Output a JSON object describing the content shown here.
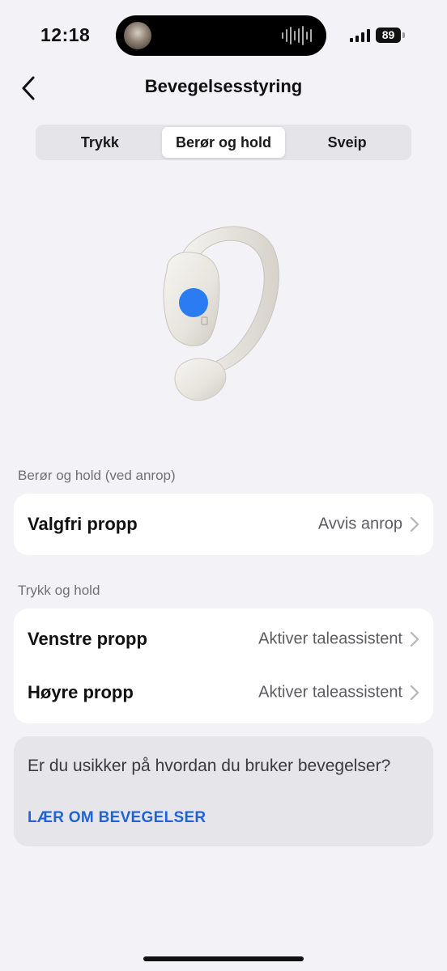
{
  "status_bar": {
    "time": "12:18",
    "battery": "89"
  },
  "header": {
    "title": "Bevegelsesstyring"
  },
  "tabs": [
    {
      "label": "Trykk"
    },
    {
      "label": "Berør og hold"
    },
    {
      "label": "Sveip"
    }
  ],
  "active_tab": "Berør og hold",
  "colors": {
    "touch_indicator": "#2b7cf2",
    "link": "#1f63d6"
  },
  "sections": [
    {
      "label": "Berør og hold (ved anrop)",
      "rows": [
        {
          "label": "Valgfri propp",
          "value": "Avvis anrop"
        }
      ]
    },
    {
      "label": "Trykk og hold",
      "rows": [
        {
          "label": "Venstre propp",
          "value": "Aktiver taleassistent"
        },
        {
          "label": "Høyre propp",
          "value": "Aktiver taleassistent"
        }
      ]
    }
  ],
  "help": {
    "text": "Er du usikker på hvordan du bruker bevegelser?",
    "link": "LÆR OM BEVEGELSER"
  },
  "icons": [
    "back-chevron-icon",
    "chevron-right-icon",
    "earbud-image"
  ]
}
